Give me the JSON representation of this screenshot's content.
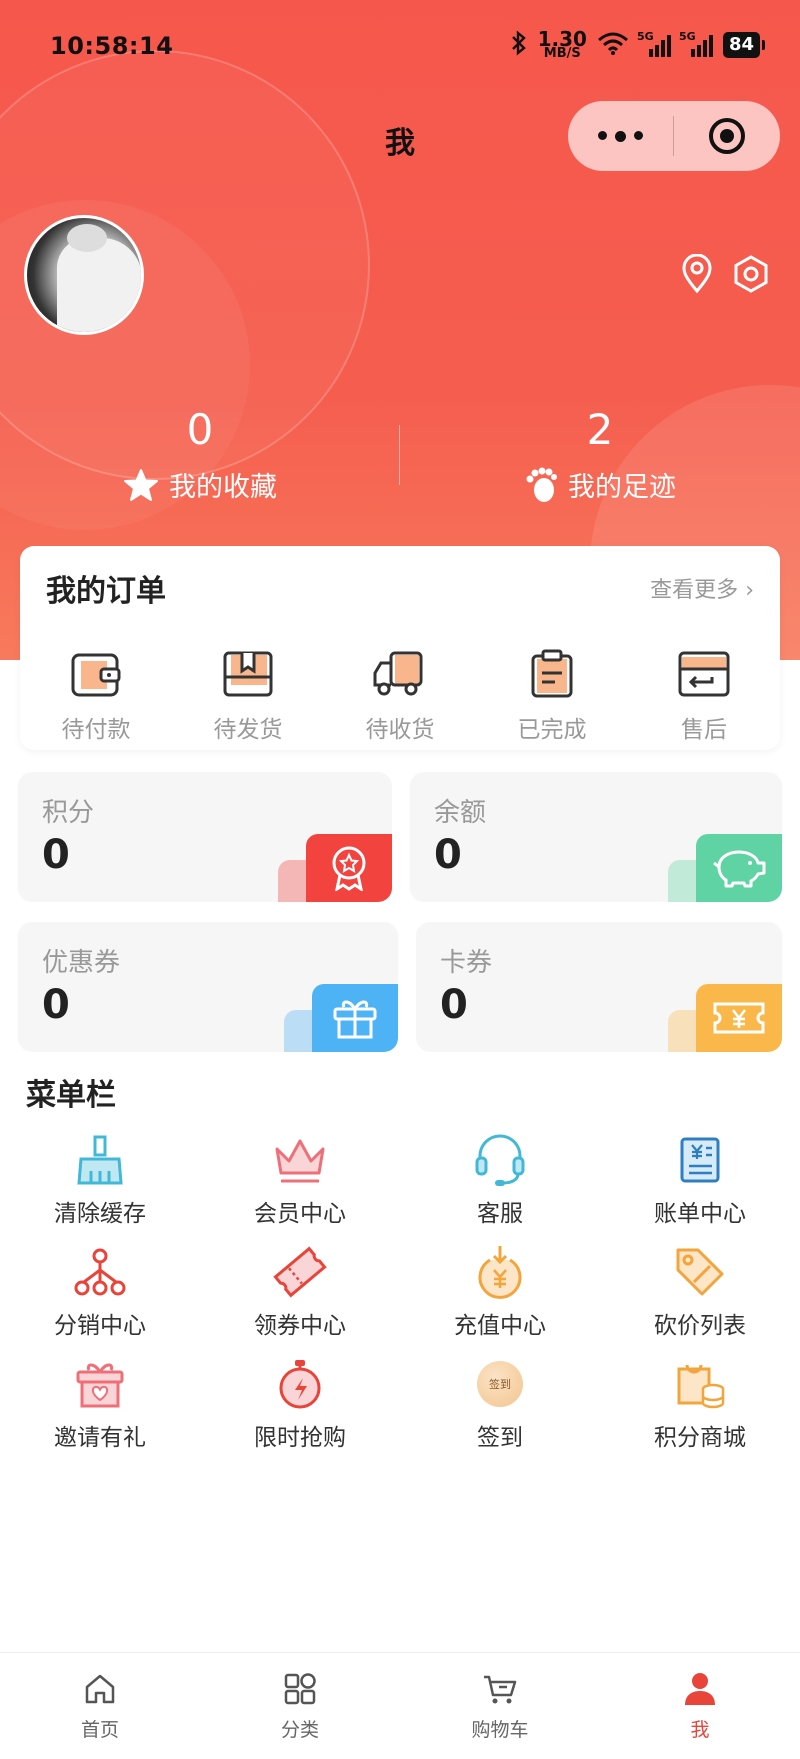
{
  "status_bar": {
    "time": "10:58:14",
    "net_speed_value": "1.30",
    "net_speed_unit": "MB/S",
    "sig1": "5G",
    "sig2": "5G",
    "battery": "84"
  },
  "nav": {
    "title": "我"
  },
  "stats": [
    {
      "count": "0",
      "label": "我的收藏",
      "icon": "star-icon"
    },
    {
      "count": "2",
      "label": "我的足迹",
      "icon": "footprint-icon"
    }
  ],
  "orders": {
    "title": "我的订单",
    "more": "查看更多",
    "items": [
      {
        "label": "待付款",
        "icon": "wallet-icon"
      },
      {
        "label": "待发货",
        "icon": "package-icon"
      },
      {
        "label": "待收货",
        "icon": "truck-icon"
      },
      {
        "label": "已完成",
        "icon": "clipboard-icon"
      },
      {
        "label": "售后",
        "icon": "return-card-icon"
      }
    ]
  },
  "assets": [
    {
      "label": "积分",
      "value": "0",
      "icon": "badge-icon",
      "color": "#f2433f"
    },
    {
      "label": "余额",
      "value": "0",
      "icon": "piggy-bank-icon",
      "color": "#5fd3a3"
    },
    {
      "label": "优惠券",
      "value": "0",
      "icon": "gift-icon",
      "color": "#4db3f5"
    },
    {
      "label": "卡券",
      "value": "0",
      "icon": "ticket-icon",
      "color": "#fbb84a"
    }
  ],
  "menu": {
    "title": "菜单栏",
    "items": [
      {
        "label": "清除缓存",
        "icon": "broom-icon"
      },
      {
        "label": "会员中心",
        "icon": "crown-icon"
      },
      {
        "label": "客服",
        "icon": "headset-icon"
      },
      {
        "label": "账单中心",
        "icon": "bill-icon"
      },
      {
        "label": "分销中心",
        "icon": "network-icon"
      },
      {
        "label": "领券中心",
        "icon": "coupon-icon"
      },
      {
        "label": "充值中心",
        "icon": "recharge-icon"
      },
      {
        "label": "砍价列表",
        "icon": "price-tag-icon"
      },
      {
        "label": "邀请有礼",
        "icon": "gift-box-icon"
      },
      {
        "label": "限时抢购",
        "icon": "stopwatch-icon"
      },
      {
        "label": "签到",
        "icon": "checkin-icon",
        "badge_text": "签到"
      },
      {
        "label": "积分商城",
        "icon": "points-mall-icon"
      }
    ]
  },
  "tabbar": [
    {
      "label": "首页",
      "icon": "home-icon"
    },
    {
      "label": "分类",
      "icon": "category-icon"
    },
    {
      "label": "购物车",
      "icon": "cart-icon"
    },
    {
      "label": "我",
      "icon": "user-icon",
      "active": true
    }
  ]
}
